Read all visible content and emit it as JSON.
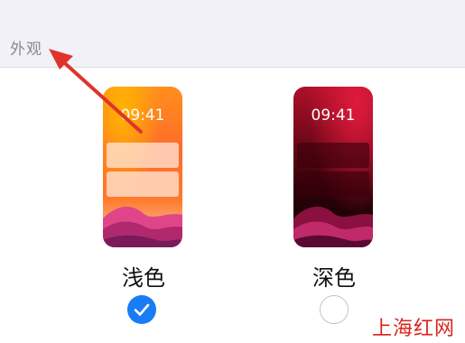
{
  "section": {
    "title": "外观"
  },
  "options": [
    {
      "label": "浅色",
      "time": "09:41",
      "selected": true
    },
    {
      "label": "深色",
      "time": "09:41",
      "selected": false
    }
  ],
  "watermark": "上海红网",
  "colors": {
    "accent": "#1a7cf5",
    "annotation_arrow": "#e0332b",
    "watermark": "#d9251c"
  },
  "icons": {
    "selected": "checkmark-icon"
  }
}
